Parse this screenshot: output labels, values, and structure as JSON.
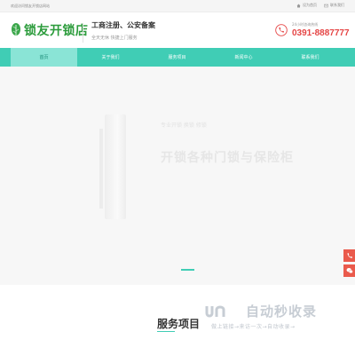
{
  "topbar": {
    "welcome": "欢迎访问锁友开锁店网站",
    "links": [
      {
        "label": "设为首页",
        "icon": "home-icon"
      },
      {
        "label": "联系我们",
        "icon": "message-icon"
      }
    ]
  },
  "header": {
    "logo_text": "锁友开锁店",
    "slogan_main": "工商注册、公安备案",
    "slogan_sub": "全天无休 快捷上门服务",
    "hotline_label": "24小时咨询热线",
    "hotline_number": "0391-8887777"
  },
  "nav": {
    "items": [
      {
        "label": "首页",
        "active": true
      },
      {
        "label": "关于我们",
        "active": false
      },
      {
        "label": "服务项目",
        "active": false
      },
      {
        "label": "新闻中心",
        "active": false
      },
      {
        "label": "联系我们",
        "active": false
      }
    ]
  },
  "banner": {
    "subtitle": "专业开锁  换锁  修锁",
    "headline": "开锁各种门锁与保险柜"
  },
  "services": {
    "title": "服务项目"
  },
  "watermark": {
    "main": "自动秒收录",
    "sub": "做上链接→来访一次→自动收录→"
  },
  "colors": {
    "accent": "#40cdb5",
    "accent_light": "#8ae4d6",
    "logo_green": "#2c9c3c",
    "hotline_red": "#e54545",
    "float_red": "#ea5a4c"
  }
}
